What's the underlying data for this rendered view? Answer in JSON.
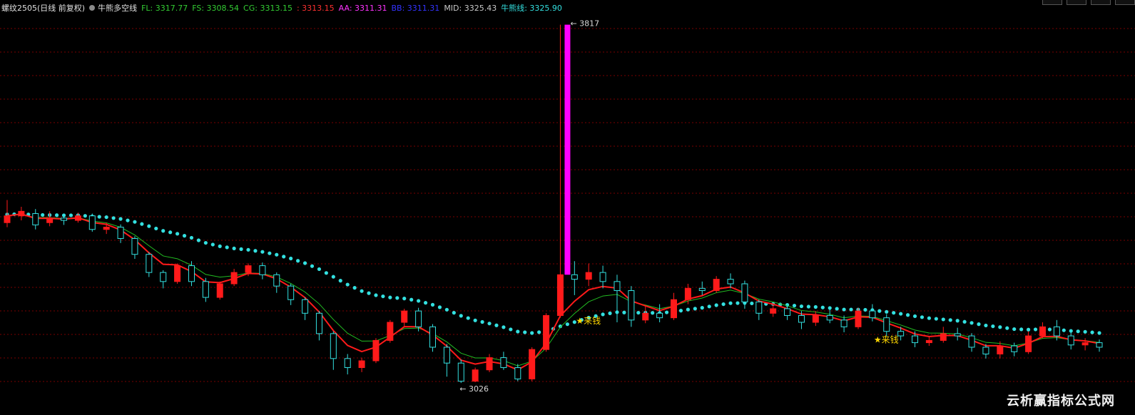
{
  "legend": {
    "symbol": "螺纹2505(日线 前复权)",
    "indicator": "牛熊多空线",
    "items": [
      {
        "label": "FL: 3317.77",
        "color": "#33cc33"
      },
      {
        "label": "FS: 3308.54",
        "color": "#33cc33"
      },
      {
        "label": "CG: 3313.15",
        "color": "#33cc33"
      },
      {
        "label": ": 3313.15",
        "color": "#ff3030"
      },
      {
        "label": "AA: 3311.31",
        "color": "#ff33ff"
      },
      {
        "label": "BB: 3311.31",
        "color": "#3333ff"
      },
      {
        "label": "MID: 3325.43",
        "color": "#c8c8c8"
      },
      {
        "label": "牛熊线: 3325.90",
        "color": "#33e0e0"
      }
    ]
  },
  "annotations": {
    "high_label": "3817",
    "low_label": "3026",
    "signal_label": "★来钱"
  },
  "watermark": "云析赢指标公式网",
  "colors": {
    "up": "#ff1a1a",
    "down": "#33e0e0",
    "spike": "#ff00ff",
    "bull_bear_line": "#33e0e0",
    "fast_line": "#ff1a1a",
    "slow_line": "#22bb22",
    "grid": "#7a0000",
    "step_line": "#e8e8e8"
  },
  "chart_data": {
    "type": "candlestick",
    "price_range": [
      2990,
      3840
    ],
    "marked_high": 3817,
    "marked_low": 3026,
    "candles": [
      [
        3380,
        3395,
        3430,
        3370
      ],
      [
        3395,
        3405,
        3415,
        3385
      ],
      [
        3400,
        3375,
        3410,
        3365
      ],
      [
        3380,
        3390,
        3405,
        3372
      ],
      [
        3390,
        3385,
        3398,
        3375
      ],
      [
        3385,
        3395,
        3402,
        3380
      ],
      [
        3395,
        3365,
        3400,
        3360
      ],
      [
        3365,
        3370,
        3380,
        3355
      ],
      [
        3370,
        3345,
        3376,
        3335
      ],
      [
        3345,
        3310,
        3350,
        3300
      ],
      [
        3310,
        3270,
        3315,
        3260
      ],
      [
        3270,
        3250,
        3275,
        3235
      ],
      [
        3250,
        3285,
        3290,
        3245
      ],
      [
        3285,
        3250,
        3295,
        3240
      ],
      [
        3250,
        3215,
        3258,
        3205
      ],
      [
        3215,
        3245,
        3250,
        3210
      ],
      [
        3245,
        3270,
        3278,
        3240
      ],
      [
        3270,
        3285,
        3290,
        3262
      ],
      [
        3285,
        3265,
        3292,
        3255
      ],
      [
        3265,
        3240,
        3270,
        3225
      ],
      [
        3240,
        3210,
        3245,
        3198
      ],
      [
        3210,
        3180,
        3215,
        3165
      ],
      [
        3180,
        3135,
        3185,
        3120
      ],
      [
        3135,
        3080,
        3140,
        3055
      ],
      [
        3080,
        3060,
        3090,
        3045
      ],
      [
        3060,
        3075,
        3082,
        3050
      ],
      [
        3075,
        3120,
        3125,
        3070
      ],
      [
        3120,
        3160,
        3165,
        3115
      ],
      [
        3160,
        3185,
        3190,
        3150
      ],
      [
        3185,
        3150,
        3192,
        3140
      ],
      [
        3150,
        3105,
        3156,
        3095
      ],
      [
        3105,
        3070,
        3112,
        3040
      ],
      [
        3070,
        3030,
        3078,
        3026
      ],
      [
        3030,
        3055,
        3060,
        3028
      ],
      [
        3055,
        3082,
        3090,
        3050
      ],
      [
        3082,
        3060,
        3095,
        3055
      ],
      [
        3060,
        3035,
        3068,
        3030
      ],
      [
        3035,
        3100,
        3105,
        3030
      ],
      [
        3100,
        3175,
        3180,
        3095
      ],
      [
        3175,
        3265,
        3817,
        3170
      ],
      [
        3265,
        3255,
        3295,
        3220
      ],
      [
        3255,
        3270,
        3290,
        3240
      ],
      [
        3270,
        3250,
        3285,
        3235
      ],
      [
        3250,
        3230,
        3265,
        3160
      ],
      [
        3230,
        3165,
        3240,
        3150
      ],
      [
        3165,
        3180,
        3195,
        3158
      ],
      [
        3180,
        3170,
        3200,
        3160
      ],
      [
        3170,
        3210,
        3225,
        3165
      ],
      [
        3210,
        3235,
        3245,
        3200
      ],
      [
        3235,
        3230,
        3250,
        3220
      ],
      [
        3230,
        3255,
        3262,
        3225
      ],
      [
        3255,
        3245,
        3268,
        3235
      ],
      [
        3245,
        3205,
        3252,
        3190
      ],
      [
        3205,
        3180,
        3210,
        3165
      ],
      [
        3180,
        3190,
        3200,
        3172
      ],
      [
        3190,
        3175,
        3198,
        3165
      ],
      [
        3175,
        3160,
        3185,
        3145
      ],
      [
        3160,
        3175,
        3185,
        3152
      ],
      [
        3175,
        3165,
        3190,
        3158
      ],
      [
        3165,
        3150,
        3175,
        3138
      ],
      [
        3150,
        3185,
        3192,
        3145
      ],
      [
        3185,
        3170,
        3200,
        3162
      ],
      [
        3170,
        3140,
        3178,
        3130
      ],
      [
        3140,
        3130,
        3150,
        3120
      ],
      [
        3130,
        3115,
        3140,
        3105
      ],
      [
        3115,
        3120,
        3130,
        3108
      ],
      [
        3120,
        3135,
        3150,
        3115
      ],
      [
        3135,
        3130,
        3148,
        3120
      ],
      [
        3130,
        3105,
        3136,
        3095
      ],
      [
        3105,
        3090,
        3112,
        3080
      ],
      [
        3090,
        3108,
        3118,
        3080
      ],
      [
        3108,
        3095,
        3115,
        3085
      ],
      [
        3095,
        3130,
        3140,
        3090
      ],
      [
        3130,
        3150,
        3160,
        3125
      ],
      [
        3150,
        3130,
        3165,
        3120
      ],
      [
        3130,
        3110,
        3138,
        3100
      ],
      [
        3110,
        3115,
        3125,
        3098
      ],
      [
        3115,
        3105,
        3122,
        3095
      ]
    ]
  }
}
